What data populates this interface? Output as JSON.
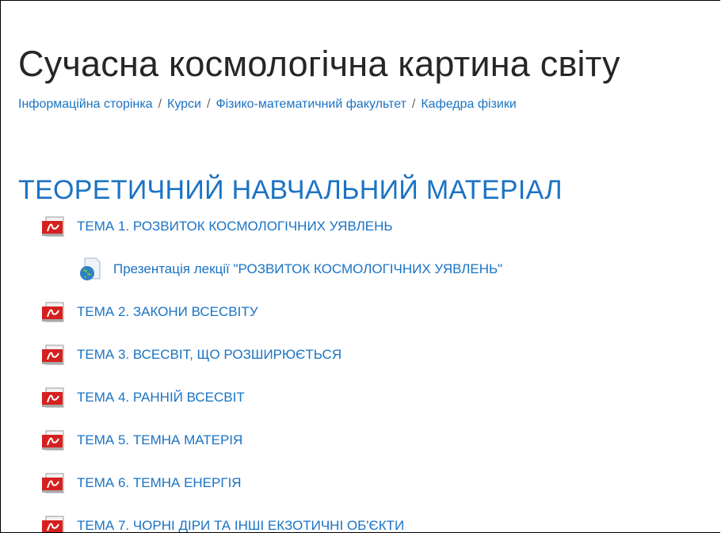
{
  "page": {
    "title": "Сучасна космологічна картина світу"
  },
  "breadcrumb": {
    "items": [
      "Інформаційна сторінка",
      "Курси",
      "Фізико-математичний факультет",
      "Кафедра фізики"
    ],
    "separator": "/"
  },
  "section": {
    "title": "ТЕОРЕТИЧНИЙ НАВЧАЛЬНИЙ МАТЕРІАЛ"
  },
  "activities": [
    {
      "label": "ТЕМА 1. РОЗВИТОК КОСМОЛОГІЧНИХ УЯВЛЕНЬ",
      "icon": "pdf-icon"
    },
    {
      "label": "Презентація лекції \"РОЗВИТОК КОСМОЛОГІЧНИХ УЯВЛЕНЬ\"",
      "icon": "url-globe-icon"
    },
    {
      "label": "ТЕМА 2. ЗАКОНИ ВСЕСВІТУ",
      "icon": "pdf-icon"
    },
    {
      "label": "ТЕМА 3. ВСЕСВІТ, ЩО РОЗШИРЮЄТЬСЯ",
      "icon": "pdf-icon"
    },
    {
      "label": "ТЕМА 4. РАННІЙ ВСЕСВІТ",
      "icon": "pdf-icon"
    },
    {
      "label": "ТЕМА 5. ТЕМНА МАТЕРІЯ",
      "icon": "pdf-icon"
    },
    {
      "label": "ТЕМА 6. ТЕМНА ЕНЕРГІЯ",
      "icon": "pdf-icon"
    },
    {
      "label": "ТЕМА 7. ЧОРНІ ДІРИ ТА ІНШІ ЕКЗОТИЧНІ ОБ'ЄКТИ",
      "icon": "pdf-icon"
    }
  ],
  "colors": {
    "link": "#1a73c4",
    "title": "#262626",
    "pdf_red": "#d6201f"
  }
}
